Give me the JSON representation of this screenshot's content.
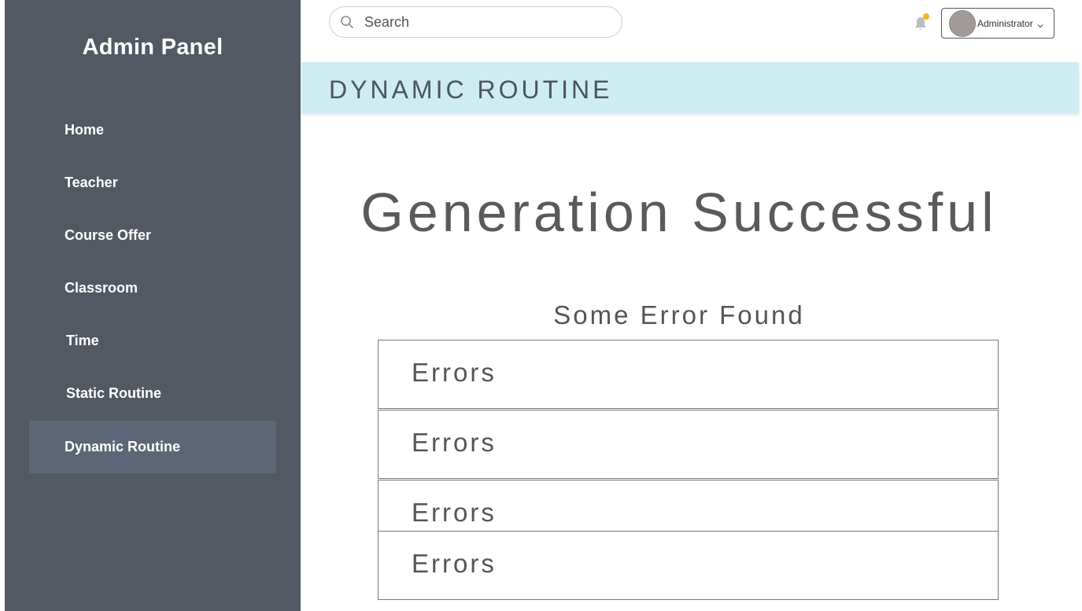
{
  "sidebar": {
    "brand": "Admin Panel",
    "items": [
      {
        "label": "Home"
      },
      {
        "label": "Teacher"
      },
      {
        "label": "Course Offer"
      },
      {
        "label": "Classroom"
      },
      {
        "label": "Time"
      },
      {
        "label": "Static Routine"
      },
      {
        "label": "Dynamic Routine",
        "active": true
      }
    ]
  },
  "topbar": {
    "search_placeholder": "Search",
    "search_icon": "search-icon",
    "bell_icon": "bell-icon",
    "notification_dot_color": "#f5b623",
    "user_label": "Administrator"
  },
  "header": {
    "title": "DYNAMIC ROUTINE"
  },
  "main": {
    "title": "Generation Successful",
    "subtitle": "Some Error Found",
    "errors": [
      "Errors",
      "Errors",
      "Errors",
      "Errors"
    ]
  },
  "colors": {
    "sidebar_bg": "#525963",
    "sidebar_active": "#5c6677",
    "header_band": "#cdedf3"
  }
}
